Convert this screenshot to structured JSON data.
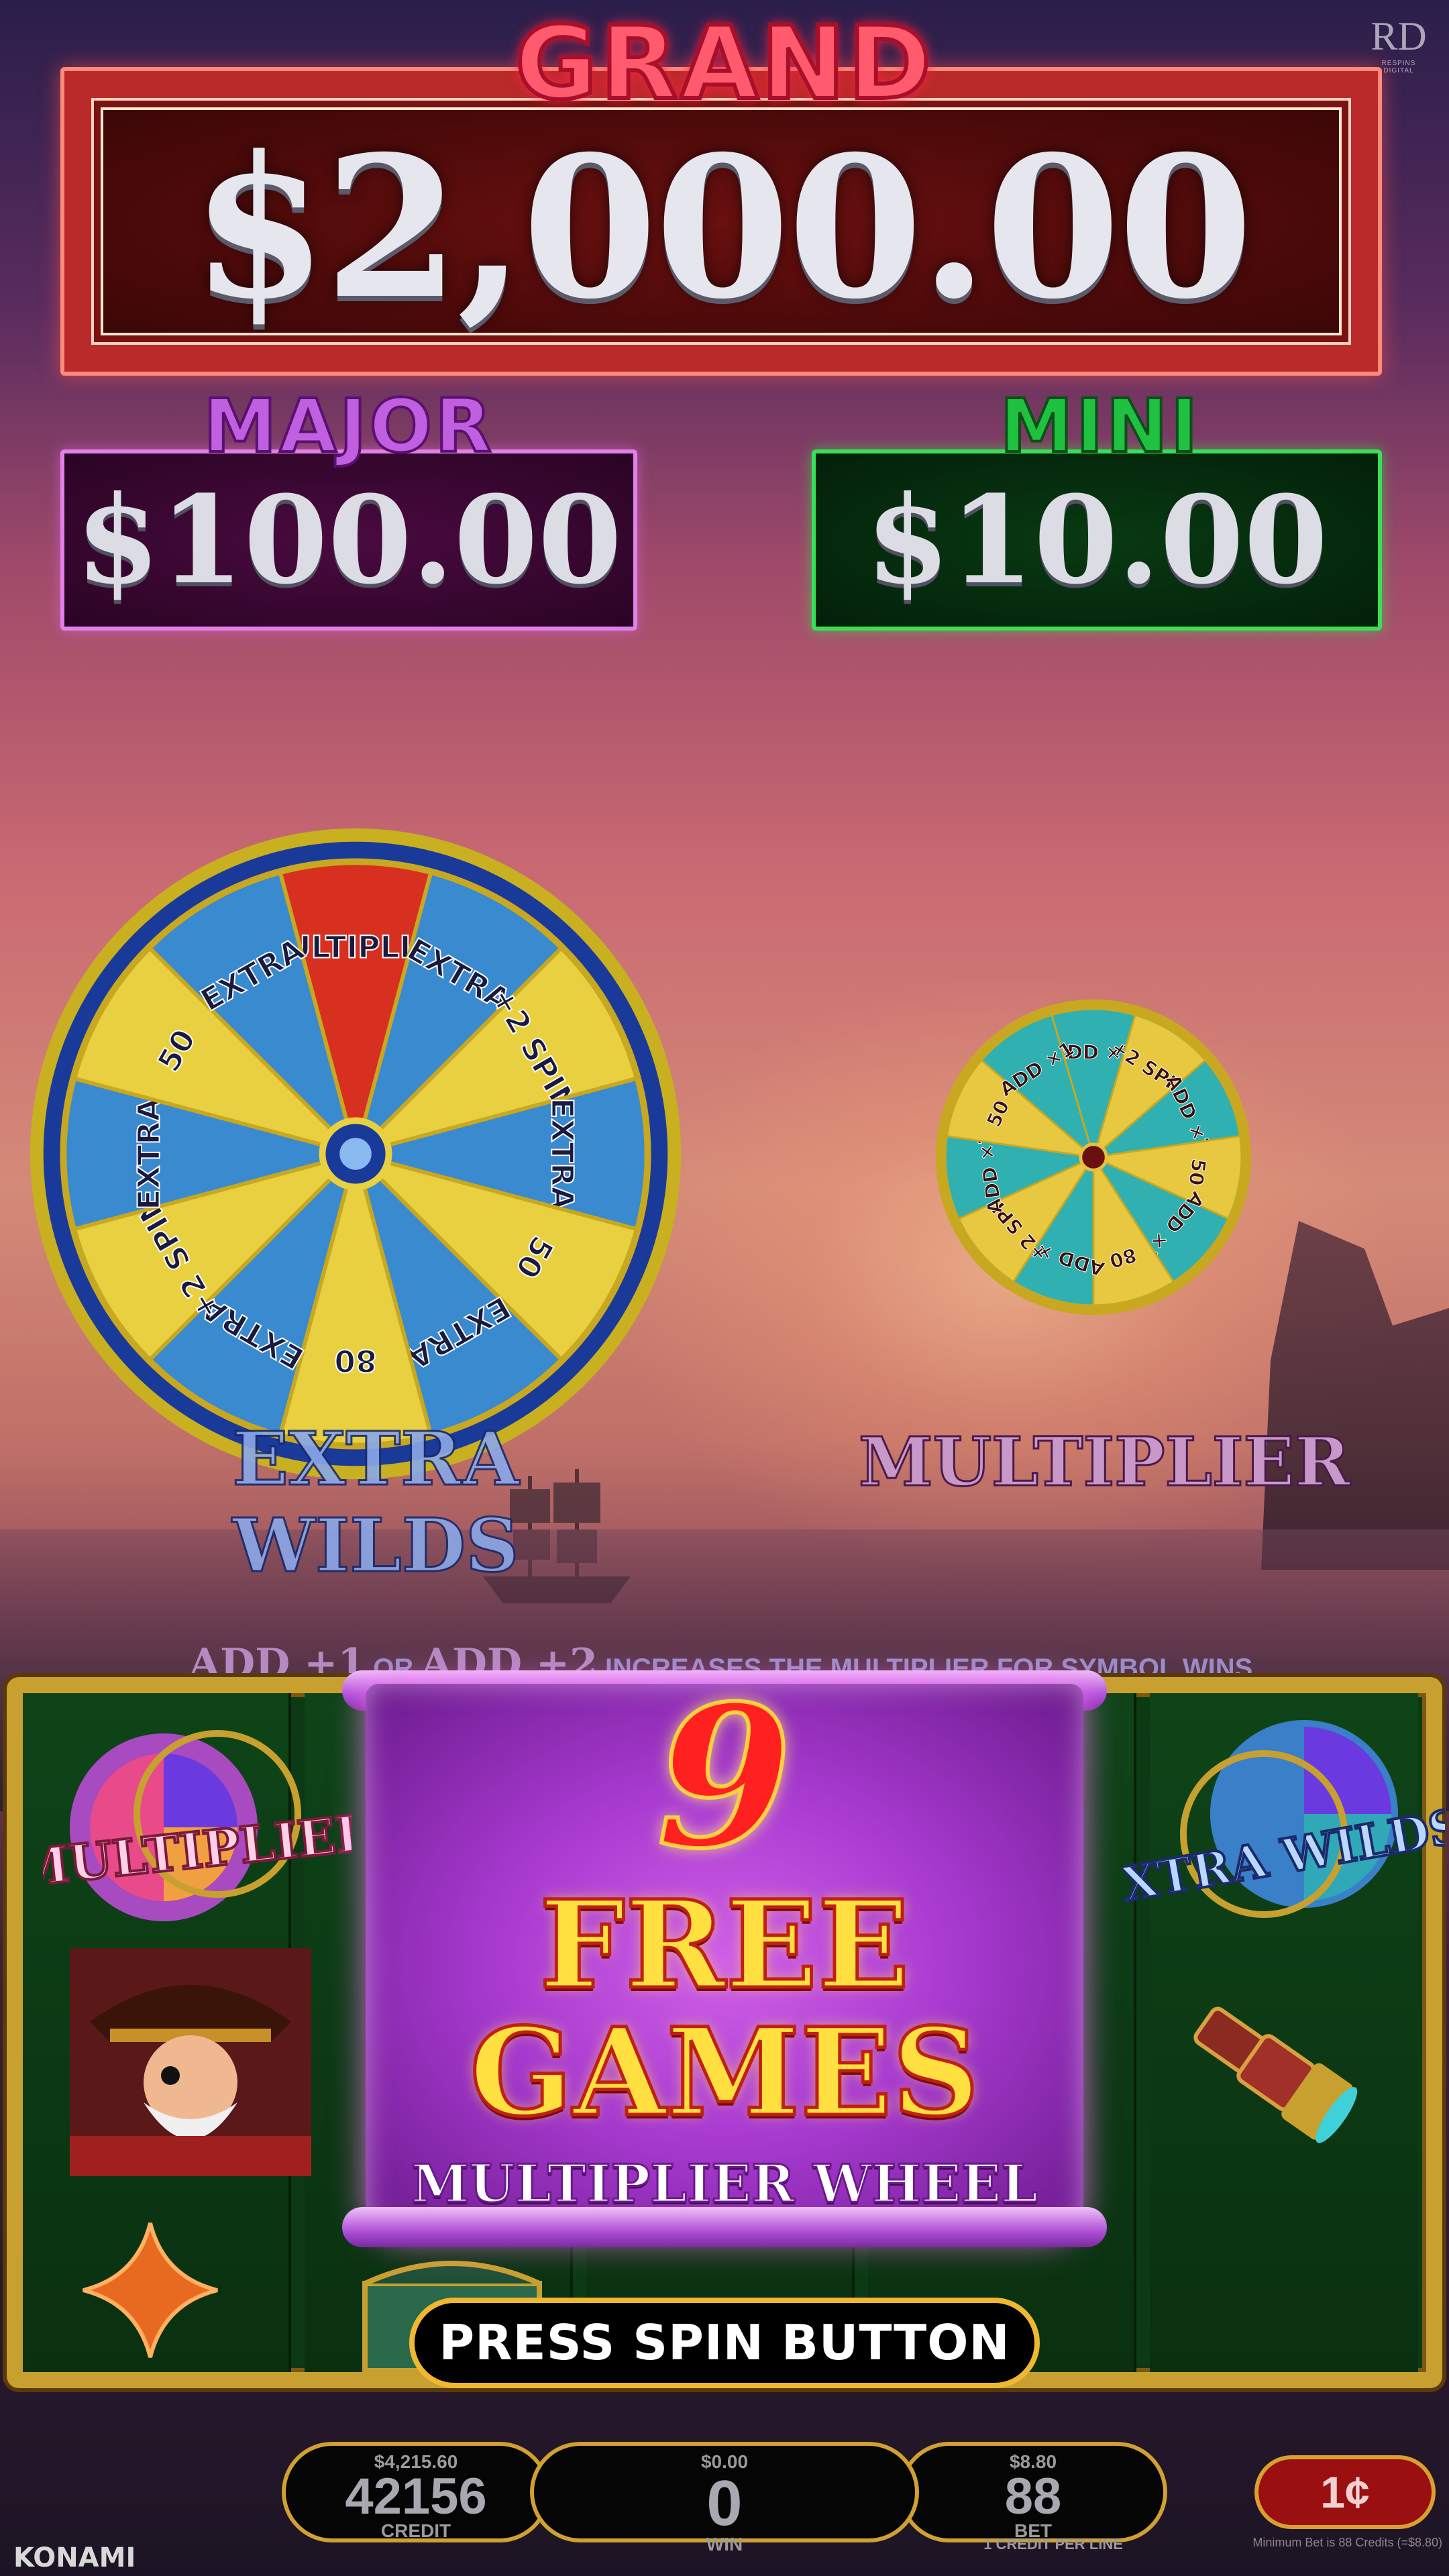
{
  "jackpots": {
    "grand": {
      "title": "GRAND",
      "value": "$2,000.00"
    },
    "major": {
      "title": "MAJOR",
      "value": "$100.00"
    },
    "mini": {
      "title": "MINI",
      "value": "$10.00"
    }
  },
  "wheels": {
    "extra_wilds": {
      "label": "EXTRA WILDS",
      "segments": [
        "MULTIPLIER",
        "EXTRA",
        "+2 SPIN",
        "EXTRA",
        "50",
        "EXTRA",
        "80",
        "EXTRA",
        "+2 SPIN",
        "EXTRA",
        "50",
        "EXTRA"
      ]
    },
    "multiplier": {
      "label": "MULTIPLIER",
      "segments": [
        "ADD ×1",
        "+2 SPIN",
        "ADD ×2",
        "50",
        "ADD ×1",
        "80",
        "ADD ×1",
        "+2 SPIN",
        "ADD ×2",
        "50",
        "ADD ×1"
      ]
    }
  },
  "info_banner": {
    "add1": "ADD +1",
    "or": "OR",
    "add2": "ADD +2",
    "rest": "INCREASES THE MULTIPLIER FOR SYMBOL WINS."
  },
  "reel_symbols": {
    "multiplier_wheel_text": "MULTIPLIER",
    "extra_wilds_wheel_text": "EXTRA WILDS"
  },
  "free_games": {
    "count": "9",
    "line1": "FREE",
    "line2": "GAMES",
    "subtitle": "MULTIPLIER WHEEL"
  },
  "press_spin": "PRESS SPIN BUTTON",
  "meters": {
    "credit": {
      "dollar": "$4,215.60",
      "value": "42156",
      "label": "CREDIT"
    },
    "win": {
      "dollar": "$0.00",
      "value": "0",
      "label": "WIN"
    },
    "bet": {
      "dollar": "$8.80",
      "value": "88",
      "label": "BET"
    }
  },
  "lines_note": "1 CREDIT PER LINE",
  "denomination": "1¢",
  "brand": "KONAMI",
  "studio_logo": "RD",
  "studio_logo_sub": "RESPINS DIGITAL",
  "min_bet_note": "Minimum Bet is 88 Credits (=$8.80)"
}
